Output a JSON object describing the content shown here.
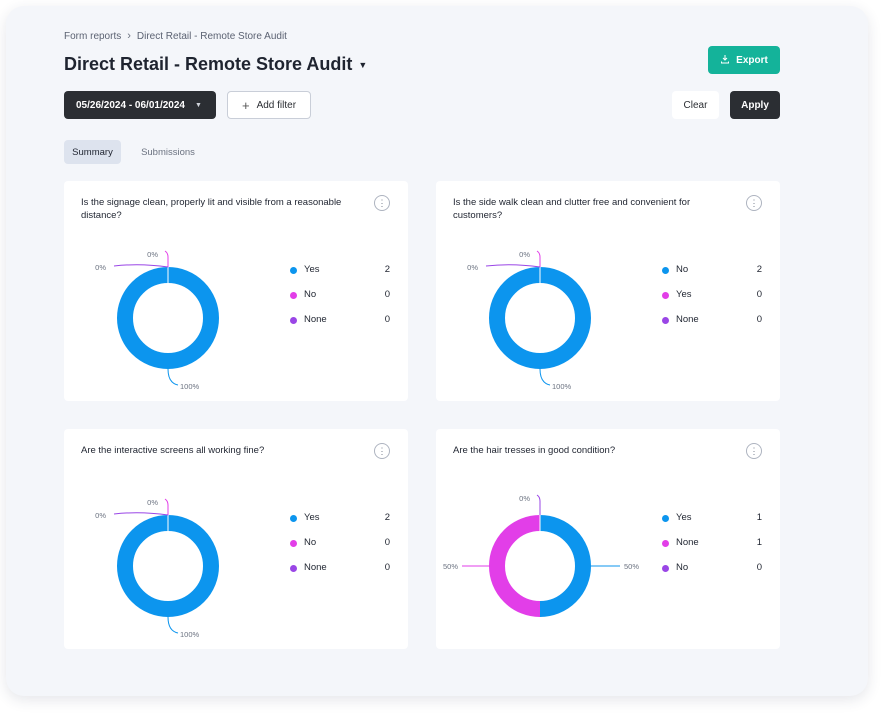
{
  "breadcrumb": {
    "parent": "Form reports",
    "separator": "›",
    "current": "Direct Retail - Remote Store Audit"
  },
  "header": {
    "title": "Direct Retail - Remote Store Audit",
    "export_label": "Export"
  },
  "filters": {
    "date_range": "05/26/2024 - 06/01/2024",
    "add_filter_label": "Add filter",
    "clear_label": "Clear",
    "apply_label": "Apply"
  },
  "tabs": [
    {
      "label": "Summary",
      "active": true
    },
    {
      "label": "Submissions",
      "active": false
    }
  ],
  "colors": {
    "blue": "#0c95ee",
    "magenta": "#e23ee8",
    "purple": "#9a46e6",
    "teal": "#14b39a",
    "dark": "#2b2e33"
  },
  "cards": [
    {
      "question": "Is the signage clean, properly lit and visible from a reasonable distance?",
      "legend": [
        {
          "label": "Yes",
          "value": "2",
          "color": "#0c95ee"
        },
        {
          "label": "No",
          "value": "0",
          "color": "#e23ee8"
        },
        {
          "label": "None",
          "value": "0",
          "color": "#9a46e6"
        }
      ],
      "chart_data": {
        "type": "pie",
        "categories": [
          "Yes",
          "No",
          "None"
        ],
        "values": [
          2,
          0,
          0
        ],
        "labels": [
          "100%",
          "0%",
          "0%"
        ]
      }
    },
    {
      "question": "Is the side walk clean and clutter free and convenient for customers?",
      "legend": [
        {
          "label": "No",
          "value": "2",
          "color": "#0c95ee"
        },
        {
          "label": "Yes",
          "value": "0",
          "color": "#e23ee8"
        },
        {
          "label": "None",
          "value": "0",
          "color": "#9a46e6"
        }
      ],
      "chart_data": {
        "type": "pie",
        "categories": [
          "No",
          "Yes",
          "None"
        ],
        "values": [
          2,
          0,
          0
        ],
        "labels": [
          "100%",
          "0%",
          "0%"
        ]
      }
    },
    {
      "question": "Are the interactive screens all working fine?",
      "legend": [
        {
          "label": "Yes",
          "value": "2",
          "color": "#0c95ee"
        },
        {
          "label": "No",
          "value": "0",
          "color": "#e23ee8"
        },
        {
          "label": "None",
          "value": "0",
          "color": "#9a46e6"
        }
      ],
      "chart_data": {
        "type": "pie",
        "categories": [
          "Yes",
          "No",
          "None"
        ],
        "values": [
          2,
          0,
          0
        ],
        "labels": [
          "100%",
          "0%",
          "0%"
        ]
      }
    },
    {
      "question": "Are the hair tresses in good condition?",
      "legend": [
        {
          "label": "Yes",
          "value": "1",
          "color": "#0c95ee"
        },
        {
          "label": "None",
          "value": "1",
          "color": "#e23ee8"
        },
        {
          "label": "No",
          "value": "0",
          "color": "#9a46e6"
        }
      ],
      "chart_data": {
        "type": "pie",
        "categories": [
          "Yes",
          "None",
          "No"
        ],
        "values": [
          1,
          1,
          0
        ],
        "labels": [
          "50%",
          "50%",
          "0%"
        ]
      }
    }
  ]
}
